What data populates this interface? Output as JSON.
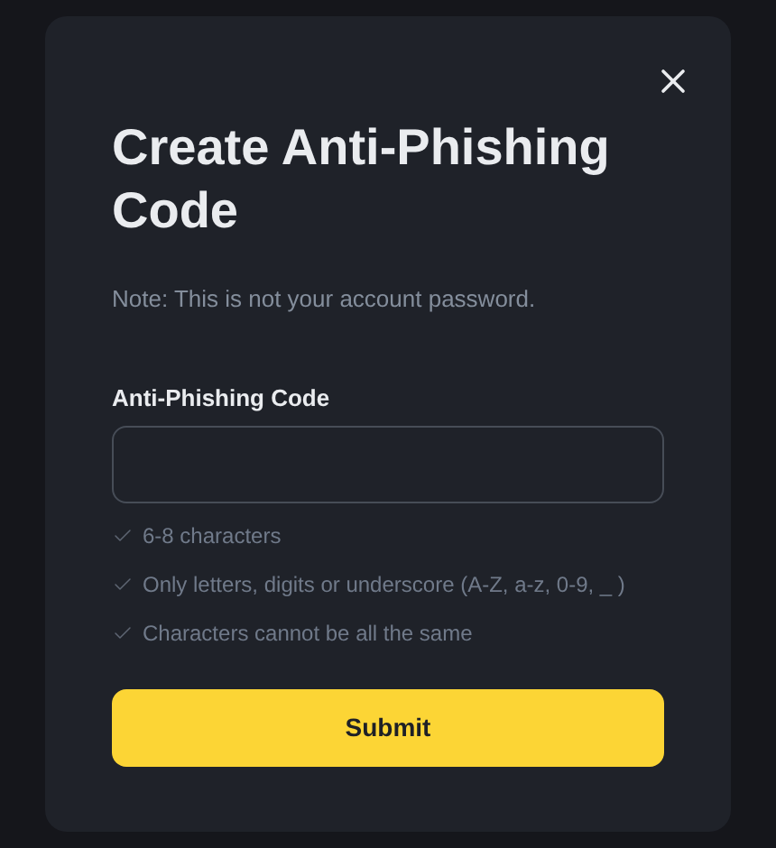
{
  "dialog": {
    "title": "Create Anti-Phishing Code",
    "note": "Note: This is not your account password.",
    "field": {
      "label": "Anti-Phishing Code"
    },
    "rules": [
      "6-8 characters",
      "Only letters, digits or underscore (A-Z, a-z, 0-9, _ )",
      "Characters cannot be all the same"
    ],
    "submit": "Submit"
  }
}
